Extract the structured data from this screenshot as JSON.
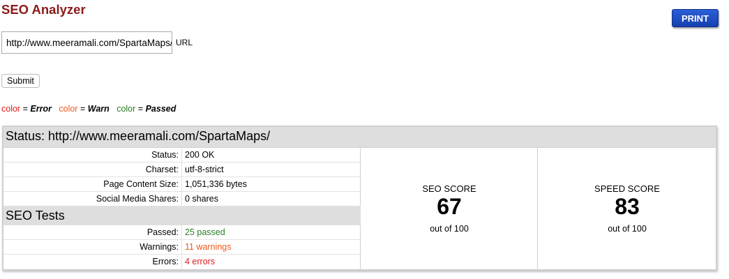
{
  "header": {
    "title": "SEO Analyzer",
    "print_label": "PRINT"
  },
  "form": {
    "url_value": "http://www.meeramali.com/SpartaMaps/",
    "url_label": "URL",
    "submit_label": "Submit"
  },
  "legend": {
    "error_word": "color",
    "error_key": "Error",
    "warn_word": "color",
    "warn_key": "Warn",
    "passed_word": "color",
    "passed_key": "Passed",
    "equals": "=",
    "colors": {
      "error": "#e21b1b",
      "warn": "#ee5a1c",
      "passed": "#2a7d2a"
    }
  },
  "status": {
    "heading": "Status: http://www.meeramali.com/SpartaMaps/",
    "rows": [
      {
        "label": "Status:",
        "value": "200 OK"
      },
      {
        "label": "Charset:",
        "value": "utf-8-strict"
      },
      {
        "label": "Page Content Size:",
        "value": "1,051,336 bytes"
      },
      {
        "label": "Social Media Shares:",
        "value": "0 shares"
      }
    ]
  },
  "seo_tests": {
    "heading": "SEO Tests",
    "rows": [
      {
        "label": "Passed:",
        "value": "25 passed"
      },
      {
        "label": "Warnings:",
        "value": "11 warnings"
      },
      {
        "label": "Errors:",
        "value": "4 errors"
      }
    ]
  },
  "scores": {
    "seo": {
      "label": "SEO SCORE",
      "value": "67",
      "sub": "out of 100"
    },
    "speed": {
      "label": "SPEED SCORE",
      "value": "83",
      "sub": "out of 100"
    }
  }
}
